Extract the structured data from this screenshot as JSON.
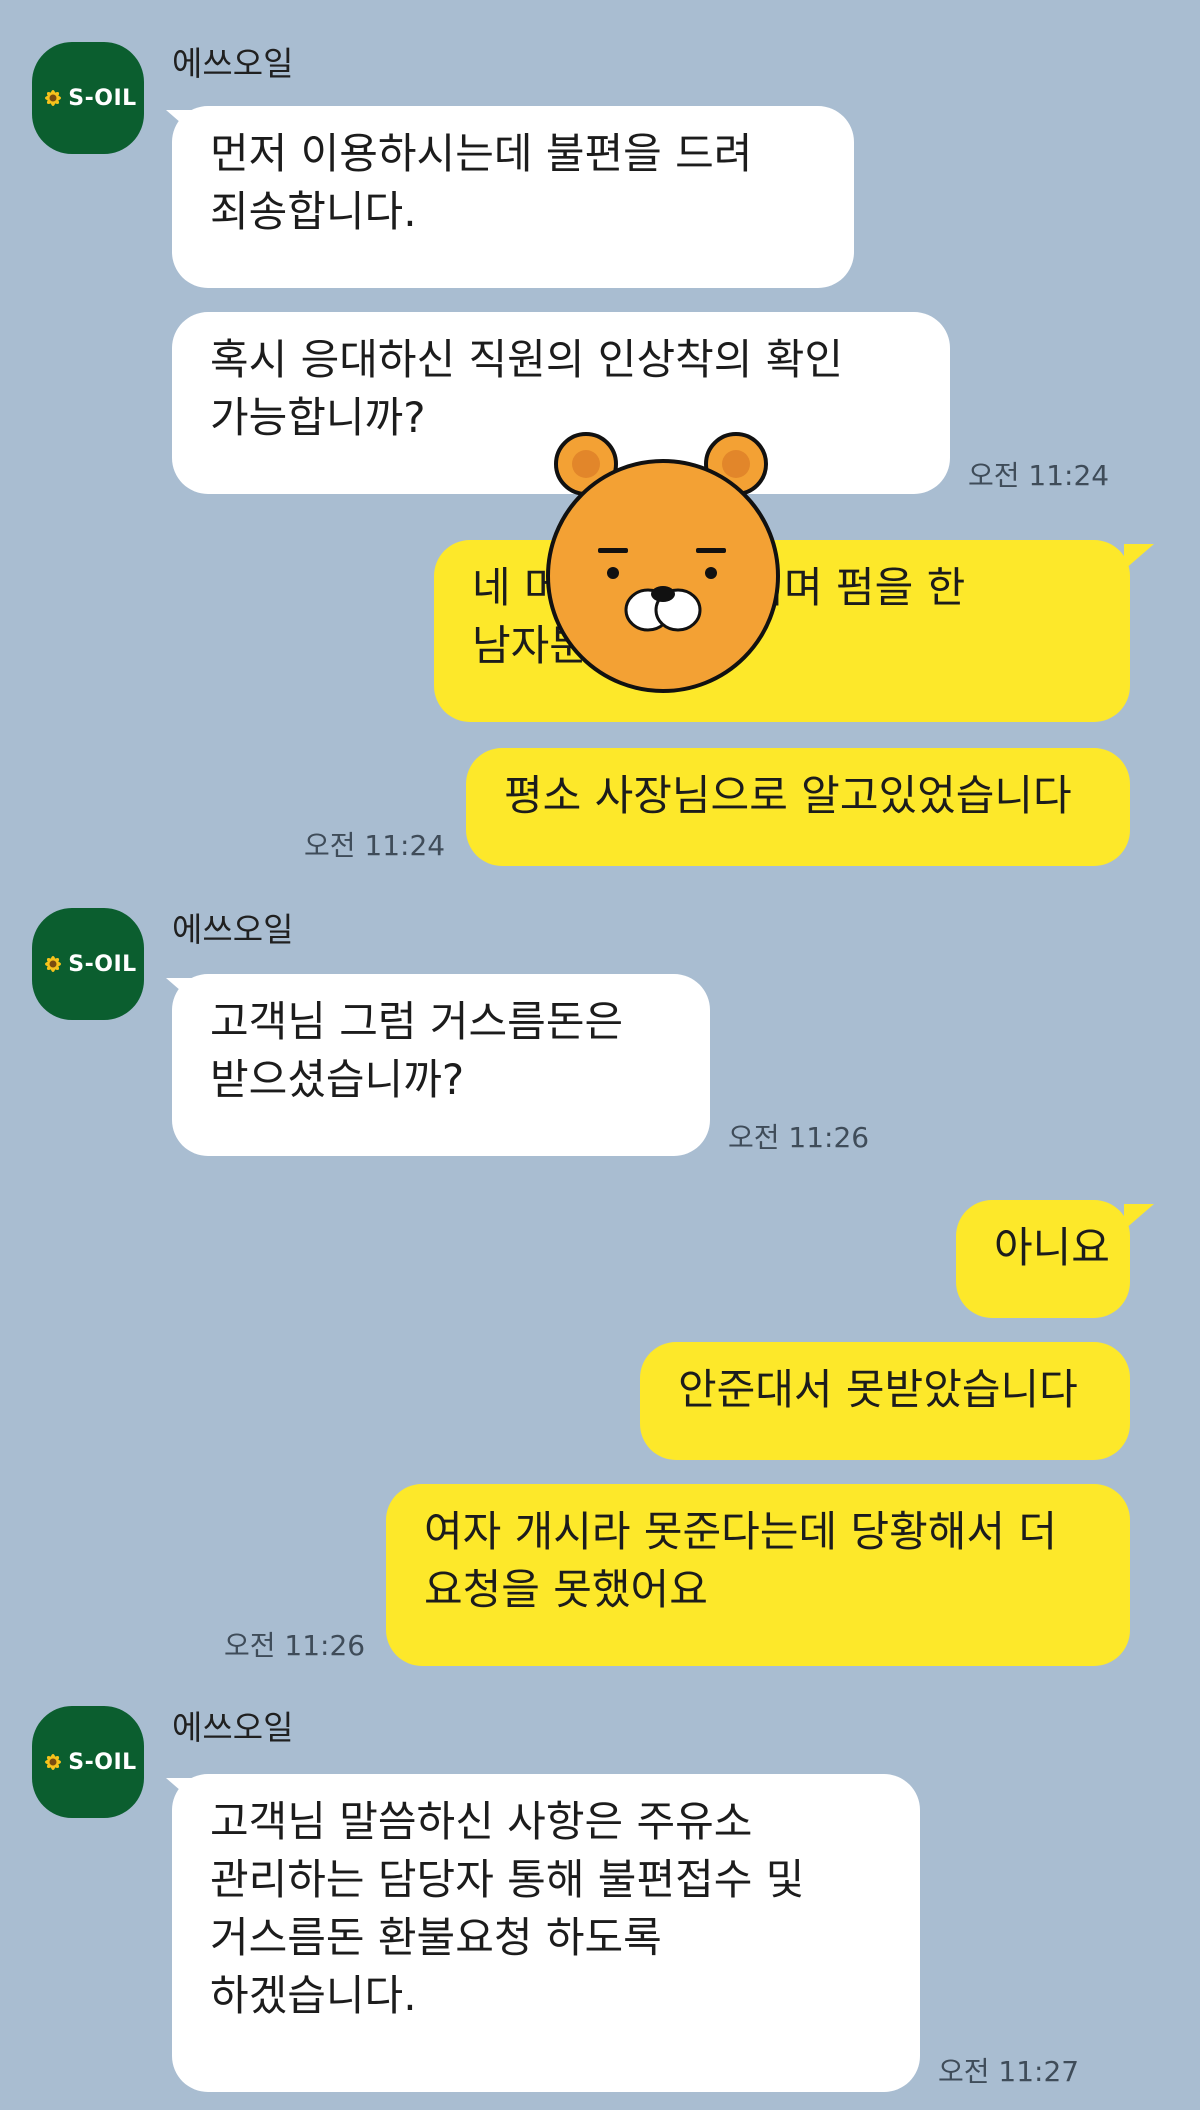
{
  "colors": {
    "background": "#a9bdd1",
    "incoming_bubble": "#ffffff",
    "outgoing_bubble": "#fde82a",
    "avatar": "#0b5e2f"
  },
  "groups": [
    {
      "sender": "에쓰오일",
      "avatar_logo": "S-OIL",
      "messages": [
        {
          "lines": [
            "먼저 이용하시는데 불편을 드려",
            "죄송합니다."
          ]
        },
        {
          "lines": [
            "혹시 응대하신 직원의 인상착의 확인",
            "가능합니까?"
          ],
          "time": "오전 11:24"
        }
      ]
    },
    {
      "outgoing": true,
      "messages": [
        {
          "lines": [
            "네 머리 ... 용하시며 펌을 한",
            "남자분 ... 니다"
          ]
        },
        {
          "lines": [
            "평소 사장님으로 알고있었습니다"
          ],
          "time": "오전 11:24"
        }
      ]
    },
    {
      "sender": "에쓰오일",
      "avatar_logo": "S-OIL",
      "messages": [
        {
          "lines": [
            "고객님 그럼 거스름돈은",
            "받으셨습니까?"
          ],
          "time": "오전 11:26"
        }
      ]
    },
    {
      "outgoing": true,
      "messages": [
        {
          "lines": [
            "아니요"
          ]
        },
        {
          "lines": [
            "안준대서 못받았습니다"
          ]
        },
        {
          "lines": [
            "여자 개시라 못준다는데 당황해서 더",
            "요청을 못했어요"
          ],
          "time": "오전 11:26"
        }
      ]
    },
    {
      "sender": "에쓰오일",
      "avatar_logo": "S-OIL",
      "messages": [
        {
          "lines": [
            "고객님 말씀하신 사항은 주유소",
            "관리하는 담당자 통해  불편접수 및",
            "거스름돈 환불요청 하도록",
            "하겠습니다."
          ],
          "time": "오전 11:27"
        }
      ]
    }
  ],
  "sticker": {
    "icon": "ryan-bear-face-icon"
  }
}
